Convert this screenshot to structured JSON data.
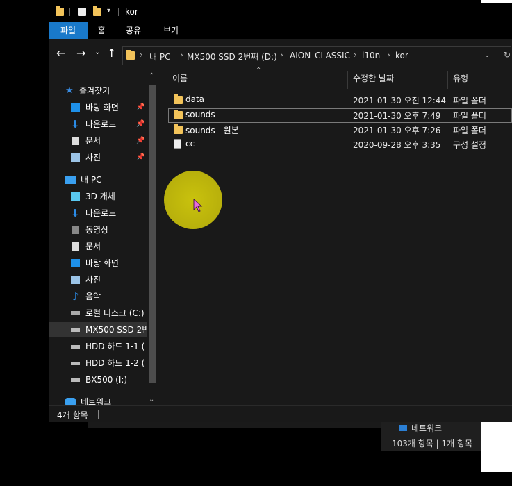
{
  "window": {
    "title": "kor",
    "ribbon_tabs": [
      {
        "label": "파일",
        "active": true
      },
      {
        "label": "홈",
        "active": false
      },
      {
        "label": "공유",
        "active": false
      },
      {
        "label": "보기",
        "active": false
      }
    ]
  },
  "address": {
    "crumbs": [
      "내 PC",
      "MX500 SSD 2번째 (D:)",
      "AION_CLASSIC",
      "l10n",
      "kor"
    ]
  },
  "sidebar": {
    "items": [
      {
        "label": "즐겨찾기",
        "icon": "star-icon",
        "pinned": false
      },
      {
        "label": "바탕 화면",
        "icon": "desktop-icon",
        "pinned": true
      },
      {
        "label": "다운로드",
        "icon": "download-icon",
        "pinned": true
      },
      {
        "label": "문서",
        "icon": "document-icon",
        "pinned": true
      },
      {
        "label": "사진",
        "icon": "pictures-icon",
        "pinned": true
      },
      {
        "label": "내 PC",
        "icon": "pc-icon",
        "pinned": false
      },
      {
        "label": "3D 개체",
        "icon": "3d-objects-icon",
        "pinned": false
      },
      {
        "label": "다운로드",
        "icon": "download-icon",
        "pinned": false
      },
      {
        "label": "동영상",
        "icon": "video-icon",
        "pinned": false
      },
      {
        "label": "문서",
        "icon": "document-icon",
        "pinned": false
      },
      {
        "label": "바탕 화면",
        "icon": "desktop-icon",
        "pinned": false
      },
      {
        "label": "사진",
        "icon": "pictures-icon",
        "pinned": false
      },
      {
        "label": "음악",
        "icon": "music-icon",
        "pinned": false
      },
      {
        "label": "로컬 디스크 (C:)",
        "icon": "local-disk-icon",
        "pinned": false
      },
      {
        "label": "MX500 SSD 2번",
        "icon": "drive-icon",
        "pinned": false,
        "selected": true
      },
      {
        "label": "HDD 하드 1-1 (",
        "icon": "drive-icon",
        "pinned": false
      },
      {
        "label": "HDD 하드 1-2 (",
        "icon": "drive-icon",
        "pinned": false
      },
      {
        "label": "BX500 (I:)",
        "icon": "drive-icon",
        "pinned": false
      },
      {
        "label": "네트워크",
        "icon": "network-icon",
        "pinned": false
      }
    ]
  },
  "columns": {
    "name": "이름",
    "date": "수정한 날짜",
    "type": "유형"
  },
  "files": [
    {
      "name": "data",
      "date": "2021-01-30 오전 12:44",
      "type": "파일 폴더",
      "icon": "folder-icon"
    },
    {
      "name": "sounds",
      "date": "2021-01-30 오후 7:49",
      "type": "파일 폴더",
      "icon": "folder-icon"
    },
    {
      "name": "sounds - 원본",
      "date": "2021-01-30 오후 7:26",
      "type": "파일 폴더",
      "icon": "folder-icon"
    },
    {
      "name": "cc",
      "date": "2020-09-28 오후 3:35",
      "type": "구성 설정",
      "icon": "config-file-icon"
    }
  ],
  "status": {
    "count": "4개 항목"
  },
  "background_window": {
    "nav_label": "네트워크",
    "status": "103개 항목  |  1개 항목"
  },
  "colors": {
    "accent": "#1979ca",
    "folder": "#f2c35a",
    "cursor_highlight": "#c9c20d"
  }
}
